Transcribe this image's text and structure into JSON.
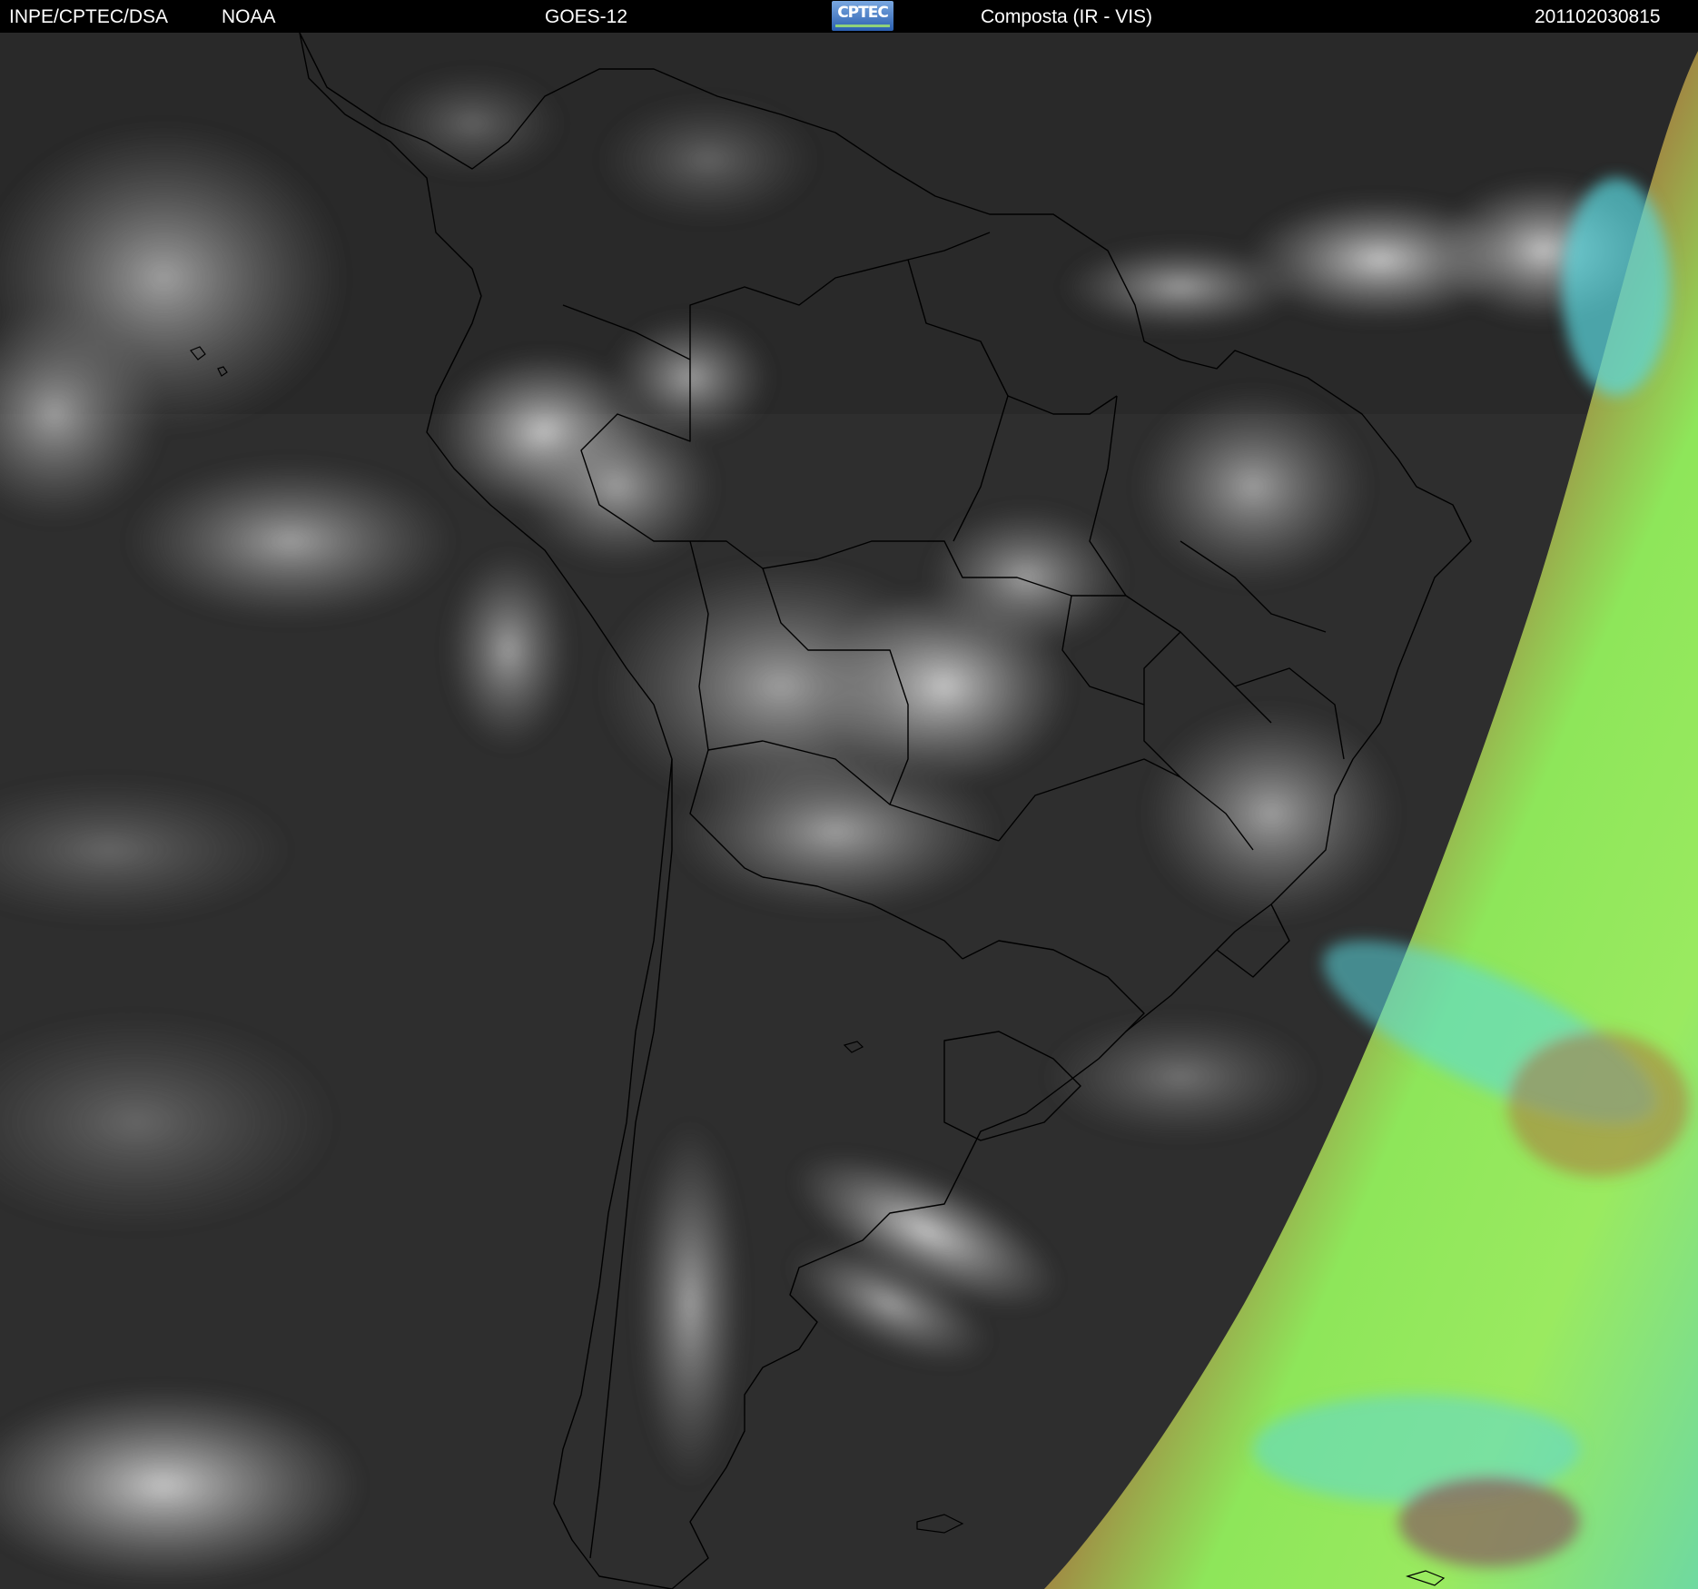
{
  "header": {
    "agency": "INPE/CPTEC/DSA",
    "partner": "NOAA",
    "satellite": "GOES-12",
    "logo_text": "CPTEC",
    "product": "Composta (IR - VIS)",
    "timestamp": "201102030815"
  },
  "image": {
    "description_icon": "satellite-composite-image",
    "colors": {
      "night_ir_dark": "#2c2c2c",
      "night_ir_mid": "#3a3a3a",
      "cloud_gray": "#8a8a8a",
      "day_vis_green": "#8ee65a",
      "day_vis_brown": "#b06a3a",
      "day_vis_cyan": "#5ad8e0",
      "border_lines": "#000000"
    }
  }
}
